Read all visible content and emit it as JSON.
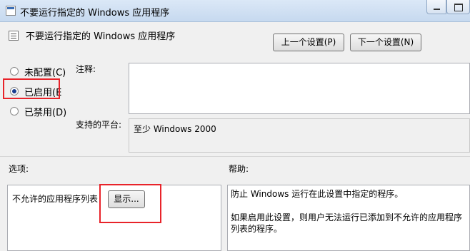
{
  "window": {
    "title": "不要运行指定的 Windows 应用程序"
  },
  "heading": {
    "text": "不要运行指定的 Windows 应用程序"
  },
  "nav": {
    "prev_label": "上一个设置(P)",
    "next_label": "下一个设置(N)"
  },
  "radios": [
    {
      "label": "未配置(C)",
      "selected": false
    },
    {
      "label": "已启用(E",
      "selected": true
    },
    {
      "label": "已禁用(D)",
      "selected": false
    }
  ],
  "labels": {
    "comment": "注释:",
    "platform": "支持的平台:",
    "options": "选项:",
    "help": "帮助:"
  },
  "comment": {
    "value": ""
  },
  "platform": {
    "value": "至少 Windows 2000"
  },
  "options": {
    "item_label": "不允许的应用程序列表",
    "show_button": "显示..."
  },
  "help": {
    "paragraph1": "防止 Windows 运行在此设置中指定的程序。",
    "paragraph2": "如果启用此设置，则用户无法运行已添加到不允许的应用程序列表的程序。"
  },
  "colors": {
    "highlight": "#e8232a",
    "titlebar": "#c6d9ef",
    "radio_dot": "#1a3d8f"
  }
}
